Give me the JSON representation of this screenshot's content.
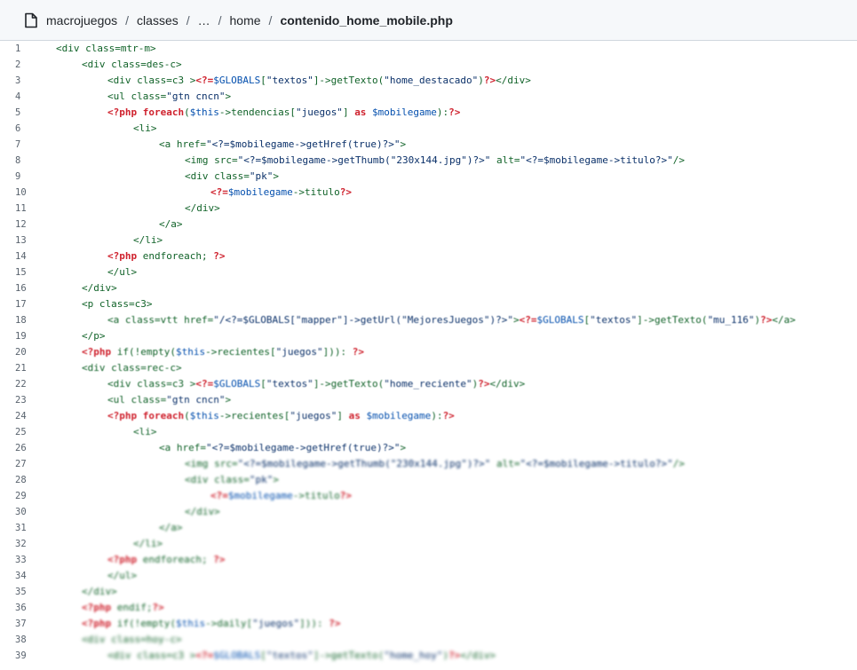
{
  "header": {
    "breadcrumbs": [
      "macrojuegos",
      "classes",
      "…",
      "home",
      "contenido_home_mobile.php"
    ],
    "separator": "/",
    "icon": "file-icon"
  },
  "colors": {
    "tag": "#116329",
    "keyword": "#cf222e",
    "variable": "#0550ae",
    "string": "#0a3069",
    "line_number": "#59636e",
    "header_bg": "#f6f8fa"
  },
  "code": {
    "lines": [
      {
        "n": "1",
        "i": 0,
        "t": [
          [
            "p",
            "<div class=mtr-m>"
          ]
        ]
      },
      {
        "n": "2",
        "i": 1,
        "t": [
          [
            "p",
            "<div class=des-c>"
          ]
        ]
      },
      {
        "n": "3",
        "i": 2,
        "t": [
          [
            "p",
            "<div class=c3 >"
          ],
          [
            "k",
            "<?="
          ],
          [
            "v",
            "$GLOBALS"
          ],
          [
            "p",
            "["
          ],
          [
            "s",
            "\"textos\""
          ],
          [
            "p",
            "]->getTexto("
          ],
          [
            "s",
            "\"home_destacado\""
          ],
          [
            "p",
            ")"
          ],
          [
            "k",
            "?>"
          ],
          [
            "p",
            "</div>"
          ]
        ]
      },
      {
        "n": "4",
        "i": 2,
        "t": [
          [
            "p",
            "<ul class="
          ],
          [
            "s",
            "\"gtn cncn\""
          ],
          [
            "p",
            ">"
          ]
        ]
      },
      {
        "n": "5",
        "i": 2,
        "t": [
          [
            "k",
            "<?php"
          ],
          [
            "p",
            " "
          ],
          [
            "k",
            "foreach"
          ],
          [
            "p",
            "("
          ],
          [
            "v",
            "$this"
          ],
          [
            "p",
            "->tendencias["
          ],
          [
            "s",
            "\"juegos\""
          ],
          [
            "p",
            "] "
          ],
          [
            "k",
            "as"
          ],
          [
            "p",
            " "
          ],
          [
            "v",
            "$mobilegame"
          ],
          [
            "p",
            "):"
          ],
          [
            "k",
            "?>"
          ]
        ]
      },
      {
        "n": "6",
        "i": 3,
        "t": [
          [
            "p",
            "<li>"
          ]
        ]
      },
      {
        "n": "7",
        "i": 4,
        "t": [
          [
            "p",
            "<a href="
          ],
          [
            "s",
            "\"<?=$mobilegame->getHref(true)?>\""
          ],
          [
            "p",
            ">"
          ]
        ]
      },
      {
        "n": "8",
        "i": 5,
        "t": [
          [
            "p",
            "<img src="
          ],
          [
            "s",
            "\"<?=$mobilegame->getThumb(\"230x144.jpg\")?>\""
          ],
          [
            "p",
            " alt="
          ],
          [
            "s",
            "\"<?=$mobilegame->titulo?>\""
          ],
          [
            "p",
            "/>"
          ]
        ]
      },
      {
        "n": "9",
        "i": 5,
        "t": [
          [
            "p",
            "<div class="
          ],
          [
            "s",
            "\"pk\""
          ],
          [
            "p",
            ">"
          ]
        ]
      },
      {
        "n": "10",
        "i": 6,
        "t": [
          [
            "k",
            "<?="
          ],
          [
            "v",
            "$mobilegame"
          ],
          [
            "p",
            "->titulo"
          ],
          [
            "k",
            "?>"
          ]
        ]
      },
      {
        "n": "11",
        "i": 5,
        "t": [
          [
            "p",
            "</div>"
          ]
        ]
      },
      {
        "n": "12",
        "i": 4,
        "t": [
          [
            "p",
            "</a>"
          ]
        ]
      },
      {
        "n": "13",
        "i": 3,
        "t": [
          [
            "p",
            "</li>"
          ]
        ]
      },
      {
        "n": "14",
        "i": 2,
        "t": [
          [
            "k",
            "<?php"
          ],
          [
            "p",
            " endforeach; "
          ],
          [
            "k",
            "?>"
          ]
        ]
      },
      {
        "n": "15",
        "i": 2,
        "t": [
          [
            "p",
            "</ul>"
          ]
        ]
      },
      {
        "n": "16",
        "i": 1,
        "t": [
          [
            "p",
            "</div>"
          ]
        ]
      },
      {
        "n": "17",
        "i": 1,
        "t": [
          [
            "p",
            "<p class=c3>"
          ]
        ]
      },
      {
        "n": "18",
        "i": 2,
        "t": [
          [
            "p",
            "<a class=vtt href="
          ],
          [
            "s",
            "\"/<?=$GLOBALS[\"mapper\"]->getUrl(\"MejoresJuegos\")?>\""
          ],
          [
            "p",
            ">"
          ],
          [
            "k",
            "<?="
          ],
          [
            "v",
            "$GLOBALS"
          ],
          [
            "p",
            "["
          ],
          [
            "s",
            "\"textos\""
          ],
          [
            "p",
            "]->getTexto("
          ],
          [
            "s",
            "\"mu_116\""
          ],
          [
            "p",
            ")"
          ],
          [
            "k",
            "?>"
          ],
          [
            "p",
            "</a>"
          ]
        ]
      },
      {
        "n": "19",
        "i": 1,
        "t": [
          [
            "p",
            "</p>"
          ]
        ]
      },
      {
        "n": "20",
        "i": 1,
        "t": [
          [
            "k",
            "<?php"
          ],
          [
            "p",
            " if(!empty("
          ],
          [
            "v",
            "$this"
          ],
          [
            "p",
            "->recientes["
          ],
          [
            "s",
            "\"juegos\""
          ],
          [
            "p",
            "])): "
          ],
          [
            "k",
            "?>"
          ]
        ]
      },
      {
        "n": "21",
        "i": 1,
        "t": [
          [
            "p",
            "<div class=rec-c>"
          ]
        ]
      },
      {
        "n": "22",
        "i": 2,
        "t": [
          [
            "p",
            "<div class=c3 >"
          ],
          [
            "k",
            "<?="
          ],
          [
            "v",
            "$GLOBALS"
          ],
          [
            "p",
            "["
          ],
          [
            "s",
            "\"textos\""
          ],
          [
            "p",
            "]->getTexto("
          ],
          [
            "s",
            "\"home_reciente\""
          ],
          [
            "p",
            ")"
          ],
          [
            "k",
            "?>"
          ],
          [
            "p",
            "</div>"
          ]
        ]
      },
      {
        "n": "23",
        "i": 2,
        "t": [
          [
            "p",
            "<ul class="
          ],
          [
            "s",
            "\"gtn cncn\""
          ],
          [
            "p",
            ">"
          ]
        ]
      },
      {
        "n": "24",
        "i": 2,
        "t": [
          [
            "k",
            "<?php"
          ],
          [
            "p",
            " "
          ],
          [
            "k",
            "foreach"
          ],
          [
            "p",
            "("
          ],
          [
            "v",
            "$this"
          ],
          [
            "p",
            "->recientes["
          ],
          [
            "s",
            "\"juegos\""
          ],
          [
            "p",
            "] "
          ],
          [
            "k",
            "as"
          ],
          [
            "p",
            " "
          ],
          [
            "v",
            "$mobilegame"
          ],
          [
            "p",
            "):"
          ],
          [
            "k",
            "?>"
          ]
        ]
      },
      {
        "n": "25",
        "i": 3,
        "t": [
          [
            "p",
            "<li>"
          ]
        ]
      },
      {
        "n": "26",
        "i": 4,
        "t": [
          [
            "p",
            "<a href="
          ],
          [
            "s",
            "\"<?=$mobilegame->getHref(true)?>\""
          ],
          [
            "p",
            ">"
          ]
        ]
      },
      {
        "n": "27",
        "i": 5,
        "t": [
          [
            "p",
            "<img src="
          ],
          [
            "s",
            "\"<?=$mobilegame->getThumb(\"230x144.jpg\")?>\""
          ],
          [
            "p",
            " alt="
          ],
          [
            "s",
            "\"<?=$mobilegame->titulo?>\""
          ],
          [
            "p",
            "/>"
          ]
        ]
      },
      {
        "n": "28",
        "i": 5,
        "t": [
          [
            "p",
            "<div class="
          ],
          [
            "s",
            "\"pk\""
          ],
          [
            "p",
            ">"
          ]
        ]
      },
      {
        "n": "29",
        "i": 6,
        "t": [
          [
            "k",
            "<?="
          ],
          [
            "v",
            "$mobilegame"
          ],
          [
            "p",
            "->titulo"
          ],
          [
            "k",
            "?>"
          ]
        ]
      },
      {
        "n": "30",
        "i": 5,
        "t": [
          [
            "p",
            "</div>"
          ]
        ]
      },
      {
        "n": "31",
        "i": 4,
        "t": [
          [
            "p",
            "</a>"
          ]
        ]
      },
      {
        "n": "32",
        "i": 3,
        "t": [
          [
            "p",
            "</li>"
          ]
        ]
      },
      {
        "n": "33",
        "i": 2,
        "t": [
          [
            "k",
            "<?php"
          ],
          [
            "p",
            " endforeach; "
          ],
          [
            "k",
            "?>"
          ]
        ]
      },
      {
        "n": "34",
        "i": 2,
        "t": [
          [
            "p",
            "</ul>"
          ]
        ]
      },
      {
        "n": "35",
        "i": 1,
        "t": [
          [
            "p",
            "</div>"
          ]
        ]
      },
      {
        "n": "36",
        "i": 1,
        "t": [
          [
            "k",
            "<?php"
          ],
          [
            "p",
            " endif;"
          ],
          [
            "k",
            "?>"
          ]
        ]
      },
      {
        "n": "37",
        "i": 1,
        "t": [
          [
            "k",
            "<?php"
          ],
          [
            "p",
            " if(!empty("
          ],
          [
            "v",
            "$this"
          ],
          [
            "p",
            "->daily["
          ],
          [
            "s",
            "\"juegos\""
          ],
          [
            "p",
            "])): "
          ],
          [
            "k",
            "?>"
          ]
        ]
      },
      {
        "n": "38",
        "i": 1,
        "t": [
          [
            "p",
            "<div class=hoy-c>"
          ]
        ]
      },
      {
        "n": "39",
        "i": 2,
        "t": [
          [
            "p",
            "<div class=c3 >"
          ],
          [
            "k",
            "<?="
          ],
          [
            "v",
            "$GLOBALS"
          ],
          [
            "p",
            "["
          ],
          [
            "s",
            "\"textos\""
          ],
          [
            "p",
            "]->getTexto("
          ],
          [
            "s",
            "\"home_hoy\""
          ],
          [
            "p",
            ")"
          ],
          [
            "k",
            "?>"
          ],
          [
            "p",
            "</div>"
          ]
        ]
      }
    ]
  }
}
